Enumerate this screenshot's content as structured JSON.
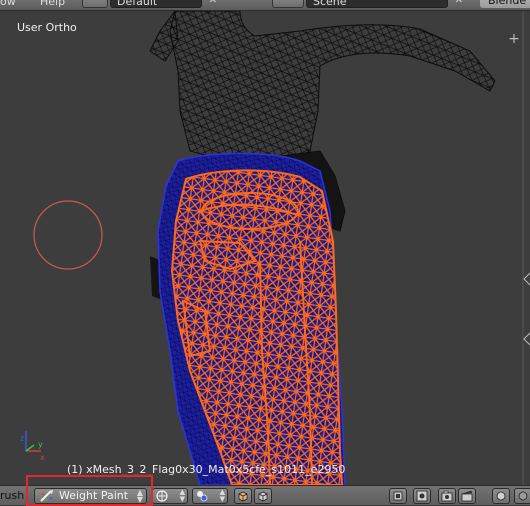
{
  "top_bar": {
    "menu_left": "ow",
    "menu_help": "Help",
    "screen_layout": "Default",
    "scene": "Scene",
    "engine": "Blende"
  },
  "viewport": {
    "view_label": "User Ortho",
    "object_info": "(1) xMesh_3_2_Flag0x30_Mat0x5cfe_s1011_e2950",
    "corner_plus": "+"
  },
  "bottom_bar": {
    "brush_label": "rush",
    "mode": "Weight Paint",
    "icons": [
      "weight-paint-icon",
      "viewport-shading-icon",
      "pivot-icon",
      "texture-paint-mask-icon",
      "vertex-select-mask-icon",
      "layers-icon",
      "render-icon",
      "camera-icon"
    ]
  },
  "colors": {
    "viewport_bg": "#3d3d3d",
    "wire_dark": "#111111",
    "wire_orange": "#ff6a1a",
    "wire_blue": "#1e20b8",
    "brush_circle": "#c45a50",
    "highlight_box": "#e02a2a"
  }
}
